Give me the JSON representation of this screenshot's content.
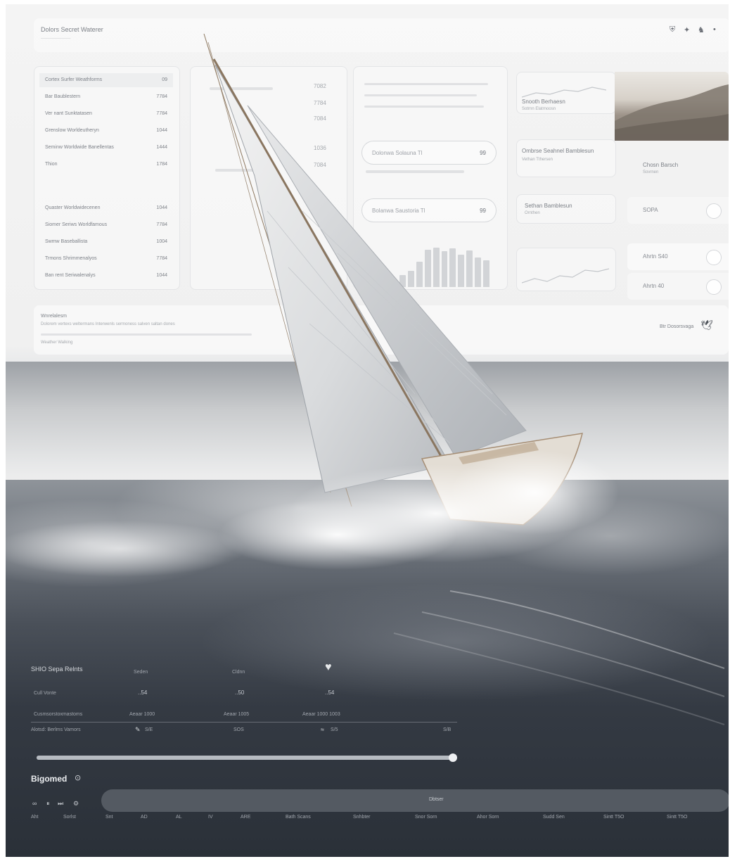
{
  "topbar": {
    "title": "Dolors Secret Waterer",
    "icons": [
      "shield-icon",
      "bell-icon",
      "user-icon",
      "more-icon"
    ]
  },
  "list_a": [
    {
      "label": "Cortex Surfer Weathforms",
      "value": "09"
    },
    {
      "label": "Bar Baublestern",
      "value": "7784"
    },
    {
      "label": "Ver nant Sunktatasen",
      "value": "7784"
    },
    {
      "label": "Grenslow Worldeutheryn",
      "value": "1044"
    },
    {
      "label": "Seminw Worldwide Banellentas",
      "value": "1444"
    },
    {
      "label": "Thion",
      "value": "1784"
    }
  ],
  "list_b": [
    {
      "label": "Quaster Worldwidecenen",
      "value": "1044"
    },
    {
      "label": "Siomer Seriws Worldfamous",
      "value": "7784"
    },
    {
      "label": "Swmw Baseballista",
      "value": "1004"
    },
    {
      "label": "Trmons Shrimmenalyos",
      "value": "7784"
    },
    {
      "label": "Ban rent Seriwalenalys",
      "value": "1044"
    }
  ],
  "col_values": [
    "7082",
    "7784",
    "7084",
    "1036",
    "7084"
  ],
  "pills": [
    {
      "label": "Dolonwa Solauna Tl",
      "value": "99"
    },
    {
      "label": "Bolanwa Saustoria Tl",
      "value": "99"
    }
  ],
  "cards": [
    {
      "title": "Snooth Berhaesn",
      "sub": "Sotrnn Elatrnoosn"
    },
    {
      "title": "Ombrse Seahnel Bamblesun",
      "sub": "Vethan Tthersen"
    },
    {
      "title": "Sethan Bamblesun",
      "sub": "Ornthen"
    }
  ],
  "side": {
    "title": "Chosn Barsch",
    "sub": "Sovrnen",
    "rows": [
      {
        "label": "SOPA"
      },
      {
        "label": "Ahrtn S40"
      },
      {
        "label": "Ahrtn 40"
      }
    ]
  },
  "notice": {
    "heading": "Wnrelalesm",
    "line": "Dolorem vertexs weltermans Interwenls sermoness salven saltan dones",
    "link": "Weather Walking",
    "button_label": "Btr Dosorsvaga"
  },
  "controls": {
    "title": "SHIO Sepa Relnts",
    "col_heads": [
      "Seden",
      "Cldnn"
    ],
    "row1_label": "Cull Vonte",
    "row1_values": [
      "..54",
      "..50",
      "..54"
    ],
    "row2_label": "Cusmsorstoxmastoms",
    "row2_values": [
      "Aeaar 1000",
      "Aeaar 1005",
      "Aeaar 1000 1003"
    ],
    "row3_label": "Alotsd: Berlms Vamors",
    "row3_values": [
      "S/E",
      "SOS",
      "S/5",
      "S/B"
    ],
    "progress": 0.99,
    "playlist_label": "Bigomed",
    "bigbar_label": "Dbtser",
    "footer_items": [
      "Aht",
      "Sorlst",
      "Snt",
      "AD",
      "AL",
      "IV",
      "ARE",
      "Bath Scans",
      "Snhbter",
      "Snor Sorn",
      "Ahor Sorn",
      "Sudd Sen",
      "Sintt T5O",
      "Sintt T5O"
    ]
  }
}
